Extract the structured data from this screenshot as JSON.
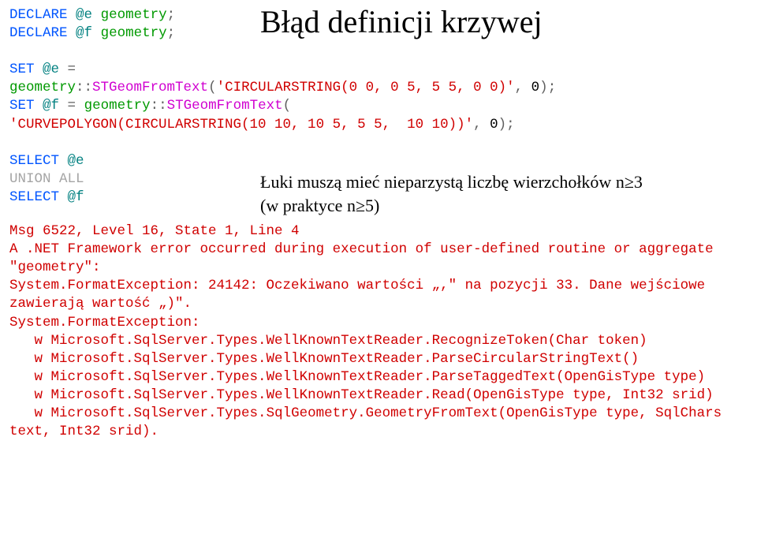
{
  "title": "Błąd definicji krzywej",
  "annotation": {
    "line1": "Łuki muszą mieć nieparzystą liczbę wierzchołków n≥3",
    "line2": "(w praktyce n≥5)"
  },
  "kw": {
    "declare": "DECLARE",
    "set": "SET",
    "select": "SELECT",
    "union": "UNION",
    "all": "ALL",
    "as": "="
  },
  "var": {
    "e": "@e",
    "f": "@f"
  },
  "type": {
    "geometry": "geometry"
  },
  "method": {
    "stgeomfromtext": "STGeomFromText"
  },
  "str": {
    "circularstring": "'CIRCULARSTRING(0 0, 0 5, 5 5, 0 0)'",
    "curvepolygon": "'CURVEPOLYGON(CIRCULARSTRING(10 10, 10 5, 5 5,  10 10))'"
  },
  "num": {
    "zero": "0"
  },
  "punct": {
    "semi": ";",
    "eq": " = ",
    "dcol": "::",
    "lparen": "(",
    "rparen": ")",
    "comma": ", "
  },
  "err": {
    "l1": "Msg 6522, Level 16, State 1, Line 4",
    "l2": "A .NET Framework error occurred during execution of user-defined routine or aggregate \"geometry\": ",
    "l3": "System.FormatException: 24142: Oczekiwano wartości „,\" na pozycji 33. Dane wejściowe zawierają wartość „)\".",
    "l4": "System.FormatException: ",
    "l5": "   w Microsoft.SqlServer.Types.WellKnownTextReader.RecognizeToken(Char token)",
    "l6": "   w Microsoft.SqlServer.Types.WellKnownTextReader.ParseCircularStringText()",
    "l7": "   w Microsoft.SqlServer.Types.WellKnownTextReader.ParseTaggedText(OpenGisType type)",
    "l8": "   w Microsoft.SqlServer.Types.WellKnownTextReader.Read(OpenGisType type, Int32 srid)",
    "l9": "   w Microsoft.SqlServer.Types.SqlGeometry.GeometryFromText(OpenGisType type, SqlChars text, Int32 srid)."
  }
}
